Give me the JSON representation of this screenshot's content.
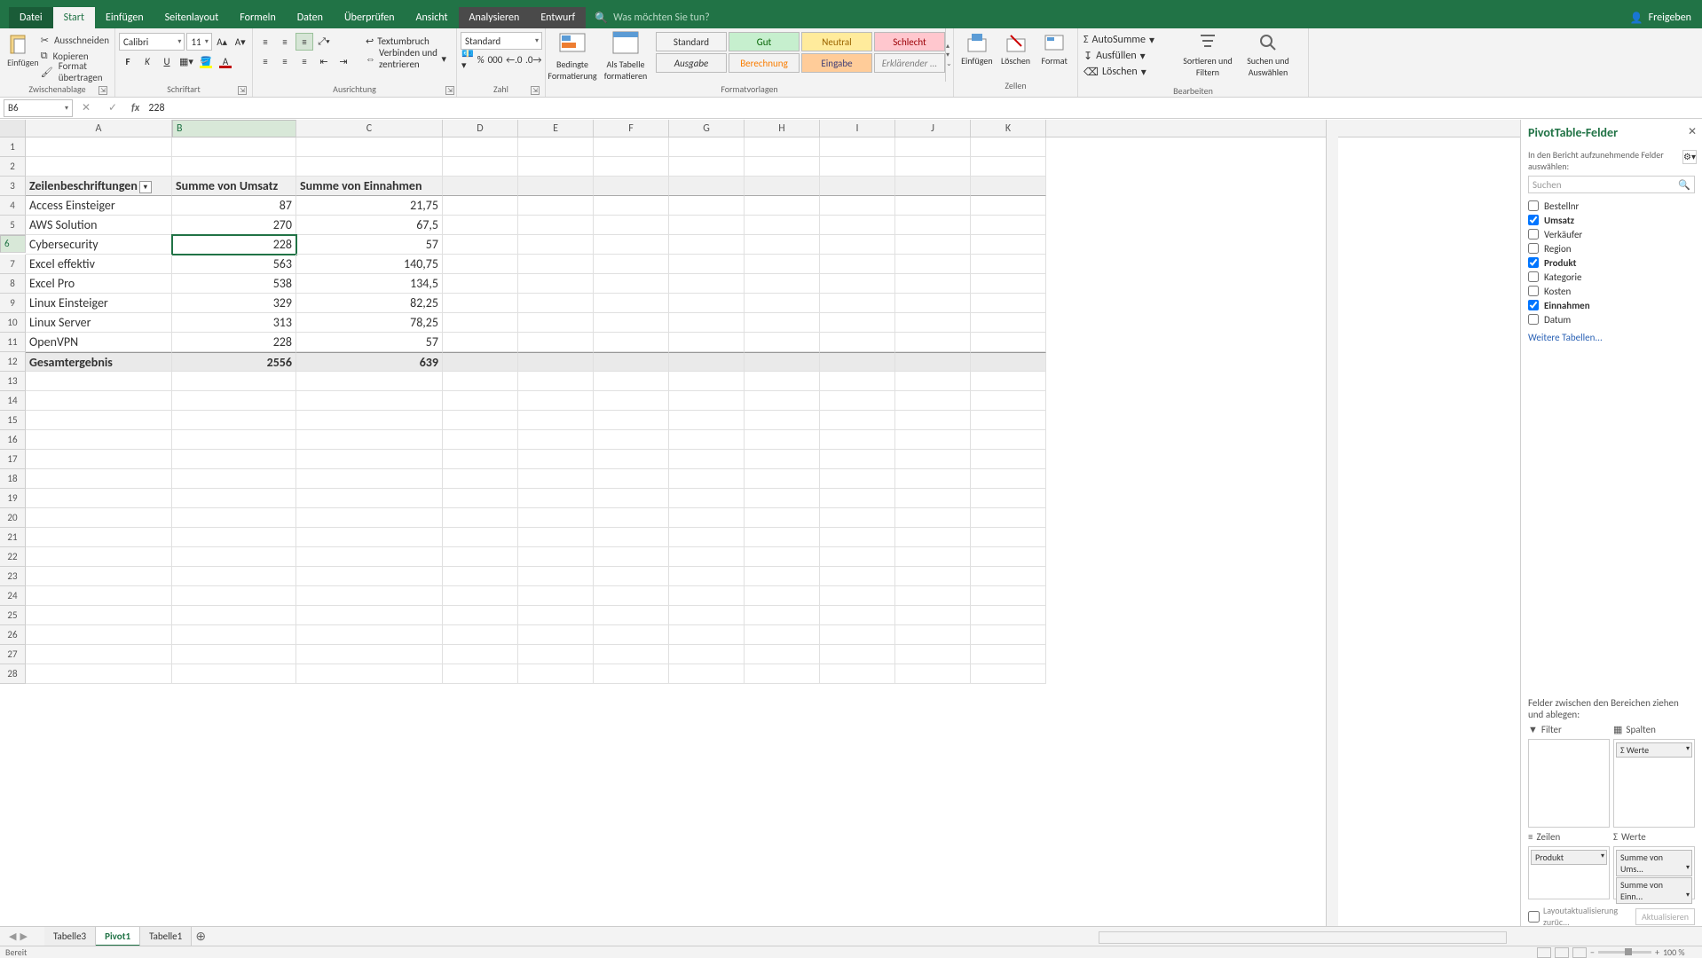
{
  "tabs": {
    "file": "Datei",
    "start": "Start",
    "einf": "Einfügen",
    "layout": "Seitenlayout",
    "formeln": "Formeln",
    "daten": "Daten",
    "ueber": "Überprüfen",
    "ansicht": "Ansicht",
    "analys": "Analysieren",
    "entwurf": "Entwurf",
    "search": "Was möchten Sie tun?",
    "share": "Freigeben"
  },
  "ribbon": {
    "clip": {
      "cut": "Ausschneiden",
      "copy": "Kopieren",
      "format": "Format übertragen",
      "paste": "Einfügen",
      "label": "Zwischenablage"
    },
    "font": {
      "name": "Calibri",
      "size": "11",
      "label": "Schriftart"
    },
    "align": {
      "wrap": "Textumbruch",
      "merge": "Verbinden und zentrieren",
      "label": "Ausrichtung"
    },
    "num": {
      "format": "Standard",
      "label": "Zahl"
    },
    "cond": {
      "bed": "Bedingte Formatierung",
      "tab": "Als Tabelle formatieren",
      "label": "Formatvorlagen",
      "std": "Standard",
      "gut": "Gut",
      "neutral": "Neutral",
      "schlecht": "Schlecht",
      "ausgabe": "Ausgabe",
      "berechnung": "Berechnung",
      "eingabe": "Eingabe",
      "erklaer": "Erklärender ..."
    },
    "cells": {
      "insert": "Einfügen",
      "delete": "Löschen",
      "format": "Format",
      "label": "Zellen"
    },
    "edit": {
      "sum": "AutoSumme",
      "fill": "Ausfüllen",
      "clear": "Löschen",
      "sort": "Sortieren und Filtern",
      "find": "Suchen und Auswählen",
      "label": "Bearbeiten"
    }
  },
  "namebox": "B6",
  "formula": "228",
  "cols": [
    "A",
    "B",
    "C",
    "D",
    "E",
    "F",
    "G",
    "H",
    "I",
    "J",
    "K"
  ],
  "pivot": {
    "headers": [
      "Zeilenbeschriftungen",
      "Summe von Umsatz",
      "Summe von Einnahmen"
    ],
    "rows": [
      {
        "a": "Access Einsteiger",
        "b": "87",
        "c": "21,75"
      },
      {
        "a": "AWS Solution",
        "b": "270",
        "c": "67,5"
      },
      {
        "a": "Cybersecurity",
        "b": "228",
        "c": "57"
      },
      {
        "a": "Excel effektiv",
        "b": "563",
        "c": "140,75"
      },
      {
        "a": "Excel Pro",
        "b": "538",
        "c": "134,5"
      },
      {
        "a": "Linux Einsteiger",
        "b": "329",
        "c": "82,25"
      },
      {
        "a": "Linux Server",
        "b": "313",
        "c": "78,25"
      },
      {
        "a": "OpenVPN",
        "b": "228",
        "c": "57"
      }
    ],
    "total": {
      "a": "Gesamtergebnis",
      "b": "2556",
      "c": "639"
    }
  },
  "pane": {
    "title": "PivotTable-Felder",
    "hint": "In den Bericht aufzunehmende Felder auswählen:",
    "search": "Suchen",
    "fields": [
      {
        "n": "Bestellnr",
        "c": false
      },
      {
        "n": "Umsatz",
        "c": true
      },
      {
        "n": "Verkäufer",
        "c": false
      },
      {
        "n": "Region",
        "c": false
      },
      {
        "n": "Produkt",
        "c": true
      },
      {
        "n": "Kategorie",
        "c": false
      },
      {
        "n": "Kosten",
        "c": false
      },
      {
        "n": "Einnahmen",
        "c": true
      },
      {
        "n": "Datum",
        "c": false
      }
    ],
    "more": "Weitere Tabellen...",
    "drag": "Felder zwischen den Bereichen ziehen und ablegen:",
    "areas": {
      "filter": "Filter",
      "cols": "Spalten",
      "rows": "Zeilen",
      "values": "Werte"
    },
    "colsdrop": "Werte",
    "rowsdrop": "Produkt",
    "valdrops": [
      "Summe von Ums...",
      "Summe von Einn..."
    ],
    "defer": "Layoutaktualisierung zurüc...",
    "update": "Aktualisieren"
  },
  "sheets": {
    "tabs": [
      "Tabelle3",
      "Pivot1",
      "Tabelle1"
    ],
    "active": 1
  },
  "status": {
    "ready": "Bereit",
    "zoom": "100 %"
  }
}
